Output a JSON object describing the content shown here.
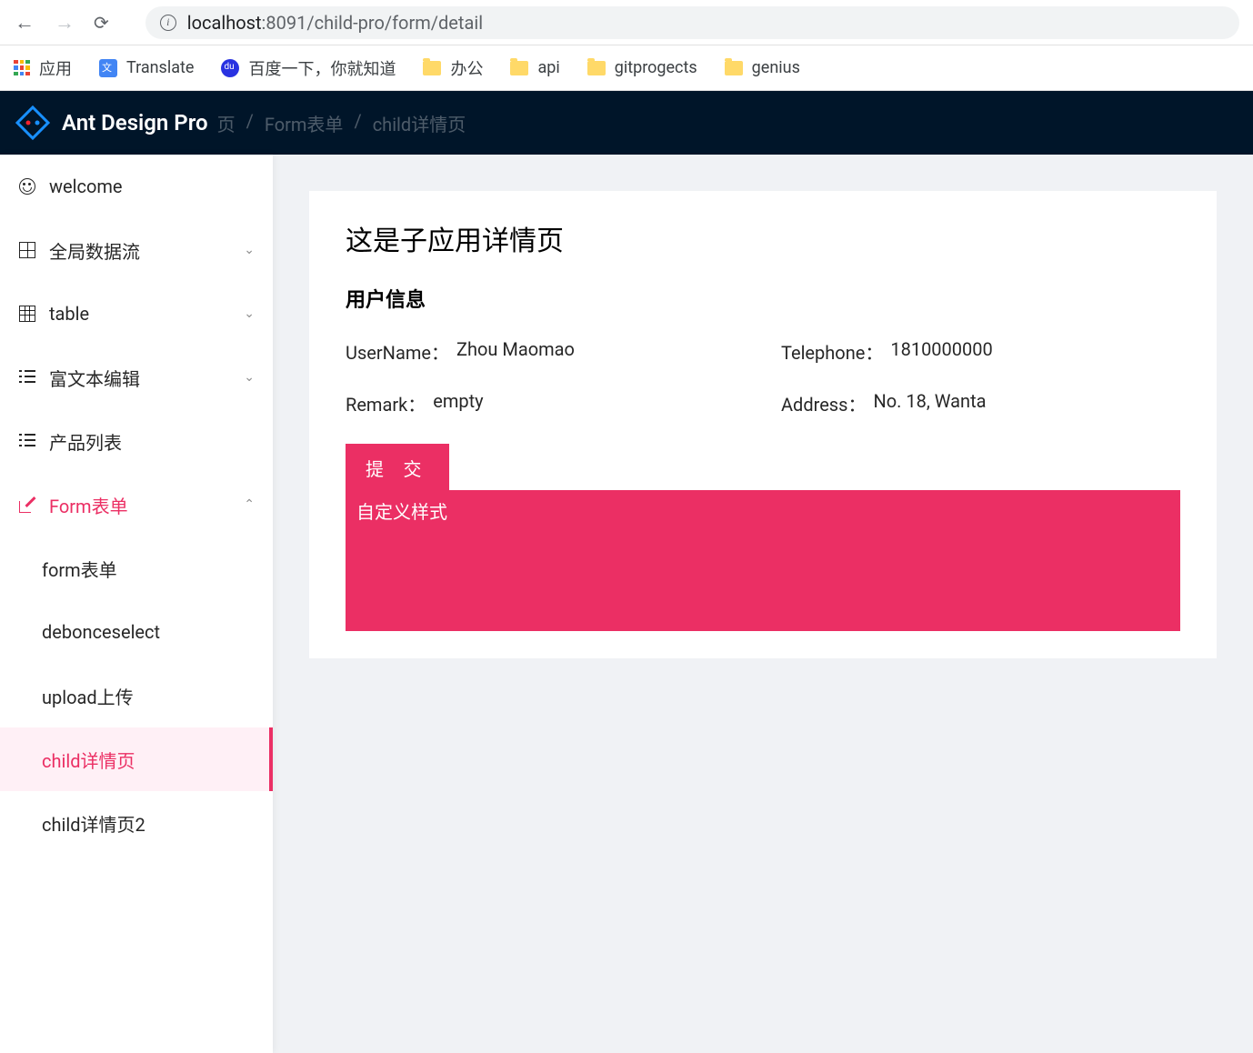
{
  "browser": {
    "url_host": "localhost",
    "url_port": ":8091",
    "url_path": "/child-pro/form/detail",
    "bookmarks": [
      {
        "label": "应用",
        "icon": "apps"
      },
      {
        "label": "Translate",
        "icon": "translate"
      },
      {
        "label": "百度一下，你就知道",
        "icon": "baidu"
      },
      {
        "label": "办公",
        "icon": "folder"
      },
      {
        "label": "api",
        "icon": "folder"
      },
      {
        "label": "gitprogects",
        "icon": "folder"
      },
      {
        "label": "genius",
        "icon": "folder"
      }
    ]
  },
  "header": {
    "title": "Ant Design Pro",
    "breadcrumb": [
      "页",
      "Form表单",
      "child详情页"
    ]
  },
  "sidebar": {
    "items": [
      {
        "label": "welcome",
        "icon": "smile",
        "expandable": false
      },
      {
        "label": "全局数据流",
        "icon": "grid",
        "expandable": true
      },
      {
        "label": "table",
        "icon": "table",
        "expandable": true
      },
      {
        "label": "富文本编辑",
        "icon": "list",
        "expandable": true
      },
      {
        "label": "产品列表",
        "icon": "list",
        "expandable": false
      },
      {
        "label": "Form表单",
        "icon": "edit",
        "expandable": true,
        "expanded": true,
        "selected": true
      }
    ],
    "submenu": [
      {
        "label": "form表单"
      },
      {
        "label": "debonceselect"
      },
      {
        "label": "upload上传"
      },
      {
        "label": "child详情页",
        "active": true
      },
      {
        "label": "child详情页2"
      }
    ]
  },
  "content": {
    "page_title": "这是子应用详情页",
    "section_title": "用户信息",
    "descriptions": [
      {
        "label": "UserName",
        "value": "Zhou Maomao"
      },
      {
        "label": "Telephone",
        "value": "1810000000"
      },
      {
        "label": "Remark",
        "value": "empty"
      },
      {
        "label": "Address",
        "value": "No. 18, Wanta"
      }
    ],
    "submit_label": "提 交",
    "custom_box": "自定义样式"
  }
}
